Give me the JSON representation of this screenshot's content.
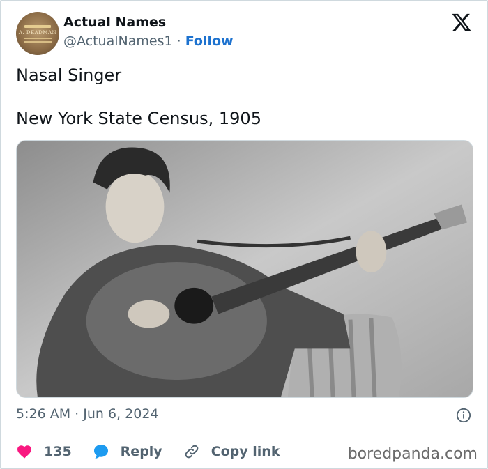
{
  "author": {
    "name": "Actual Names",
    "handle": "@ActualNames1",
    "separator": "·",
    "follow_label": "Follow",
    "avatar_text": "A. DEADMAN"
  },
  "tweet": {
    "line1": "Nasal Singer",
    "line2": "New York State Census, 1905"
  },
  "photo": {
    "icon": "black-and-white-photo-guitarist"
  },
  "meta": {
    "time": "5:26 AM",
    "separator": "·",
    "date": "Jun 6, 2024"
  },
  "actions": {
    "likes_count": "135",
    "reply_label": "Reply",
    "copy_label": "Copy link"
  },
  "watermark": "boredpanda.com",
  "colors": {
    "accent": "#1d72cf",
    "like": "#f91880",
    "reply": "#1d9bf0",
    "muted": "#536471"
  }
}
